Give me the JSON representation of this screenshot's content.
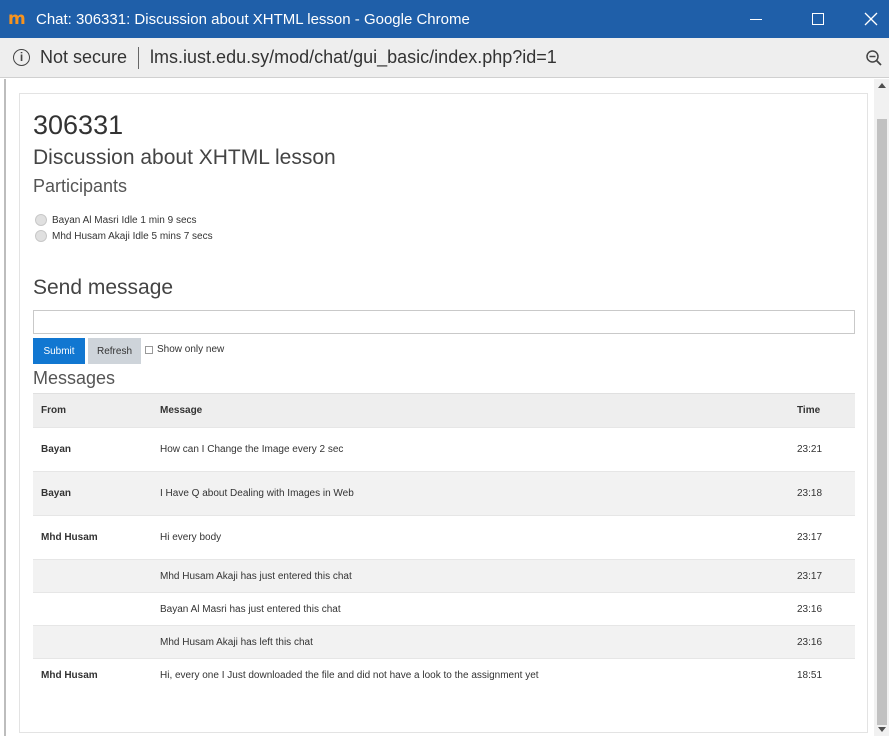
{
  "window": {
    "logo": "m",
    "title": "Chat: 306331: Discussion about XHTML lesson - Google Chrome"
  },
  "addressbar": {
    "security": "Not secure",
    "url": "lms.iust.edu.sy/mod/chat/gui_basic/index.php?id=1"
  },
  "page": {
    "title": "306331",
    "subtitle": "Discussion about XHTML lesson",
    "participants_heading": "Participants",
    "participants": [
      "Bayan Al Masri Idle 1 min 9 secs",
      "Mhd Husam Akaji Idle 5 mins 7 secs"
    ],
    "send_heading": "Send message",
    "message_value": "",
    "submit_label": "Submit",
    "refresh_label": "Refresh",
    "show_only_new_label": "Show only new",
    "show_only_new_checked": false,
    "messages_heading": "Messages"
  },
  "table": {
    "headers": {
      "from": "From",
      "message": "Message",
      "time": "Time"
    },
    "rows": [
      {
        "from": "Bayan",
        "message": "How can I Change the Image every 2 sec",
        "time": "23:21"
      },
      {
        "from": "Bayan",
        "message": "I Have Q about Dealing with Images in Web",
        "time": "23:18"
      },
      {
        "from": "Mhd Husam",
        "message": "Hi every body",
        "time": "23:17"
      },
      {
        "from": "",
        "message": "Mhd Husam Akaji has just entered this chat",
        "time": "23:17"
      },
      {
        "from": "",
        "message": "Bayan Al Masri has just entered this chat",
        "time": "23:16"
      },
      {
        "from": "",
        "message": "Mhd Husam Akaji has left this chat",
        "time": "23:16"
      },
      {
        "from": "Mhd Husam",
        "message": "Hi, every one I Just downloaded the file and did not have a look to the assignment yet",
        "time": "18:51"
      }
    ]
  },
  "colors": {
    "titlebar": "#1f5fa9",
    "logo": "#f7931e",
    "submit": "#1177d1",
    "refresh": "#ced4da"
  }
}
